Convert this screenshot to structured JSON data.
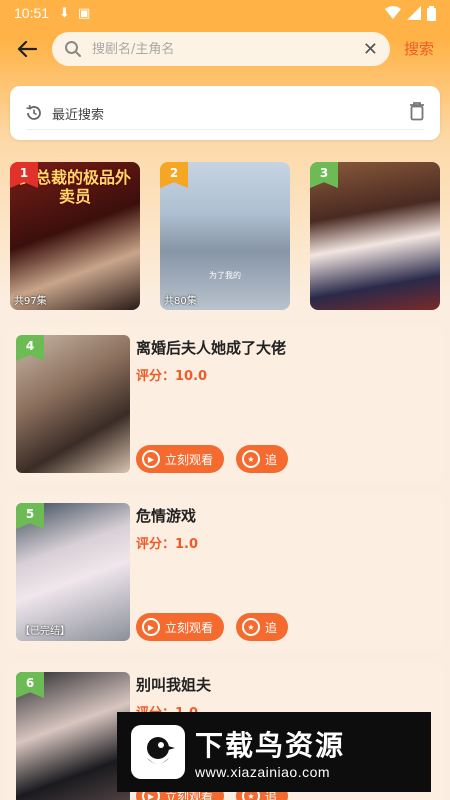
{
  "status": {
    "time": "10:51"
  },
  "search": {
    "placeholder": "搜剧名/主角名",
    "value": "",
    "submit": "搜索"
  },
  "recent": {
    "label": "最近搜索"
  },
  "top3": [
    {
      "rank": "1",
      "rank_color": "#e0312b",
      "title": "女总裁的极品外卖员",
      "episodes": "共97集"
    },
    {
      "rank": "2",
      "rank_color": "#f5a623",
      "caption": "为了我的",
      "episodes": "共80集"
    },
    {
      "rank": "3",
      "rank_color": "#6dbb55"
    }
  ],
  "list": [
    {
      "rank": "4",
      "title": "离婚后夫人她成了大佬",
      "score": "评分：10.0",
      "badge": "",
      "watch": "立刻观看",
      "follow": "追"
    },
    {
      "rank": "5",
      "title": "危情游戏",
      "score": "评分：1.0",
      "badge": "【已完结】",
      "watch": "立刻观看",
      "follow": "追"
    },
    {
      "rank": "6",
      "title": "别叫我姐夫",
      "score": "评分：1.0",
      "badge": "",
      "watch": "立刻观看",
      "follow": "追"
    }
  ],
  "watermark": {
    "brand": "下载鸟资源",
    "url": "www.xiazainiao.com"
  },
  "colors": {
    "accent": "#f05a28",
    "button": "#f56a2e",
    "header": "#ffb347"
  }
}
